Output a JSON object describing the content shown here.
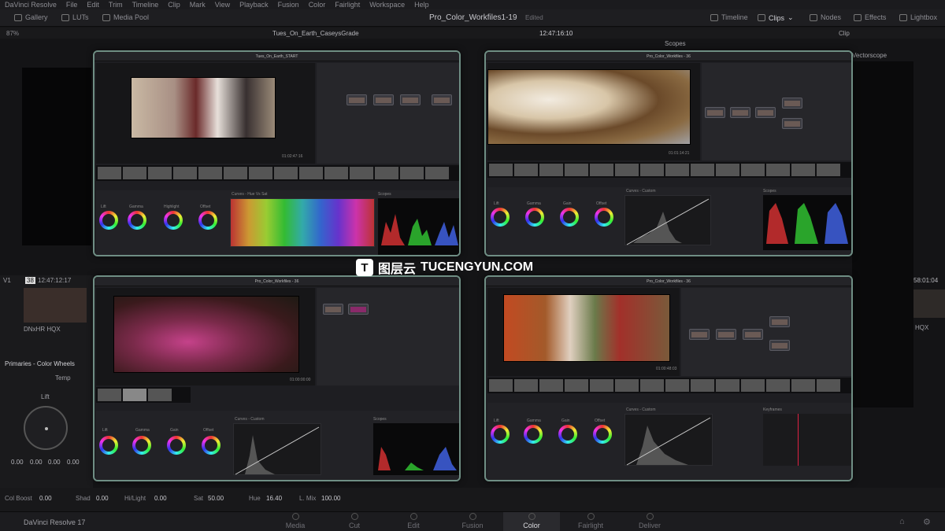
{
  "menu": [
    "DaVinci Resolve",
    "File",
    "Edit",
    "Trim",
    "Timeline",
    "Clip",
    "Mark",
    "View",
    "Playback",
    "Fusion",
    "Color",
    "Fairlight",
    "Workspace",
    "Help"
  ],
  "toolbar": {
    "gallery": "Gallery",
    "luts": "LUTs",
    "media_pool": "Media Pool",
    "project_title": "Pro_Color_Workfiles1-19",
    "edited": "Edited",
    "timeline": "Timeline",
    "clips": "Clips",
    "nodes": "Nodes",
    "effects": "Effects",
    "lightbox": "Lightbox"
  },
  "viewer": {
    "zoom": "87%",
    "timeline_name": "Tues_On_Earth_CaseysGrade",
    "timecode": "12:47:16:10",
    "scopes": "Scopes",
    "clip": "Clip",
    "scope_type": "Vectorscope"
  },
  "clipinfo": {
    "clip_num": "38",
    "timecode": "12:47:12:17",
    "track": "V1",
    "codec": "DNxHR HQX",
    "right_timecode": "58:01:04",
    "right_codec": "HQX"
  },
  "primaries": {
    "title": "Primaries - Color Wheels",
    "temp": "Temp",
    "lift": "Lift",
    "lift_values": [
      "0.00",
      "0.00",
      "0.00",
      "0.00"
    ],
    "col_boost_label": "Col Boost",
    "col_boost": "0.00",
    "shad_label": "Shad",
    "shad": "0.00",
    "hilight_label": "Hi/Light",
    "hilight": "0.00",
    "sat_label": "Sat",
    "sat": "50.00",
    "hue_label": "Hue",
    "hue": "16.40",
    "lmix_label": "L. Mix",
    "lmix": "100.00"
  },
  "pages": [
    "Media",
    "Cut",
    "Edit",
    "Fusion",
    "Color",
    "Fairlight",
    "Deliver"
  ],
  "active_page": "Color",
  "app_name": "DaVinci Resolve 17",
  "watermark": {
    "logo": "T",
    "cn": "图层云",
    "en": "TUCENGYUN.COM"
  },
  "shots": [
    {
      "title": "Tues_On_Earth_START",
      "wheels": [
        "Lift",
        "Gamma",
        "Highlight",
        "Offset"
      ],
      "curve": "Curves - Hue Vs Sat",
      "scope": "Scopes",
      "tc": "01:02:47:16"
    },
    {
      "title": "Pro_Color_Workfiles - 36",
      "wheels": [
        "Lift",
        "Gamma",
        "Gain",
        "Offset"
      ],
      "curve": "Curves - Custom",
      "scope": "Scopes",
      "tc": "01:01:14:21"
    },
    {
      "title": "Pro_Color_Workfiles - 36",
      "wheels": [
        "Lift",
        "Gamma",
        "Gain",
        "Offset"
      ],
      "curve": "Curves - Custom",
      "scope": "Scopes",
      "tc": "01:00:00:00"
    },
    {
      "title": "Pro_Color_Workfiles - 36",
      "wheels": [
        "Lift",
        "Gamma",
        "Gain",
        "Offset"
      ],
      "curve": "Curves - Custom",
      "scope": "Keyframes",
      "tc": "01:00:48:03"
    }
  ]
}
